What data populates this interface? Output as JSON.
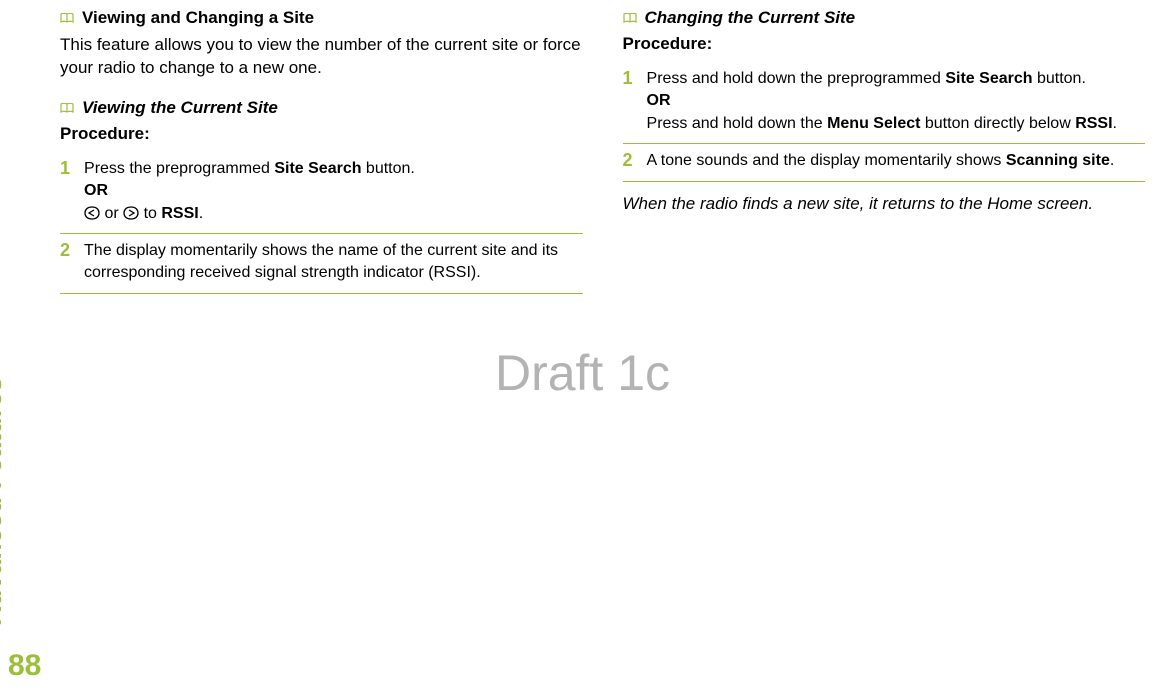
{
  "sidebar": {
    "section_label": "Advanced Features",
    "page_number": "88"
  },
  "watermark": "Draft 1c",
  "left": {
    "main_heading": "Viewing and Changing a Site",
    "intro": "This feature allows you to view the number of the current site or force your radio to change to a new one.",
    "sub_heading": "Viewing the Current Site",
    "procedure_label": "Procedure:",
    "steps": [
      {
        "num": "1",
        "line1_a": "Press the preprogrammed ",
        "line1_b_bold": "Site Search",
        "line1_c": " button.",
        "or": "OR",
        "line2_mid": " or ",
        "line2_to": " to ",
        "line2_rssi": "RSSI",
        "line2_end": "."
      },
      {
        "num": "2",
        "text": "The display momentarily shows the name of the current site and its corresponding received signal strength indicator (RSSI)."
      }
    ]
  },
  "right": {
    "sub_heading": "Changing the Current Site",
    "procedure_label": "Procedure:",
    "steps": [
      {
        "num": "1",
        "line1_a": "Press and hold down the preprogrammed ",
        "line1_b_bold": "Site Search",
        "line1_c": " button.",
        "or": "OR",
        "line2_a": "Press and hold down the ",
        "line2_b_bold": "Menu Select",
        "line2_c": " button directly below ",
        "line2_rssi": "RSSI",
        "line2_end": "."
      },
      {
        "num": "2",
        "line_a": "A tone sounds and the display momentarily shows ",
        "line_scan": "Scanning site",
        "line_end": "."
      }
    ],
    "note": "When the radio finds a new site, it returns to the Home screen."
  }
}
